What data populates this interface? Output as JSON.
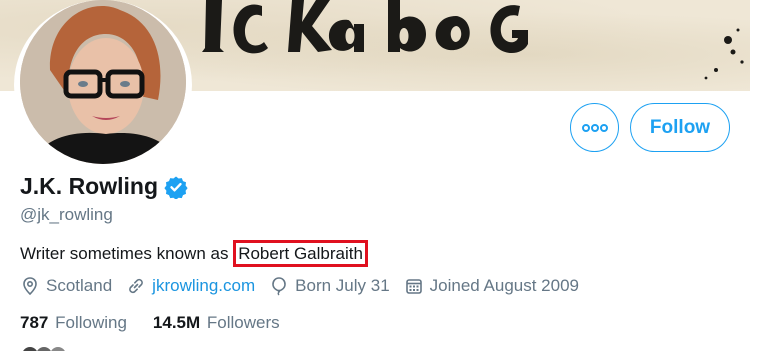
{
  "banner": {
    "art_text": "ICKABOG"
  },
  "profile": {
    "display_name": "J.K. Rowling",
    "handle": "@jk_rowling",
    "verified": true,
    "bio_prefix": "Writer sometimes known as ",
    "bio_highlight": "Robert Galbraith"
  },
  "actions": {
    "follow_label": "Follow",
    "more_icon": "more-dots-icon"
  },
  "meta": {
    "location": "Scotland",
    "url": "jkrowling.com",
    "birthday": "Born July 31",
    "joined": "Joined August 2009"
  },
  "stats": {
    "following_count": "787",
    "following_label": "Following",
    "followers_count": "14.5M",
    "followers_label": "Followers"
  },
  "colors": {
    "accent": "#1da1f2",
    "link": "#1b95e0",
    "muted": "#657786",
    "highlight_box": "#e0101f"
  }
}
